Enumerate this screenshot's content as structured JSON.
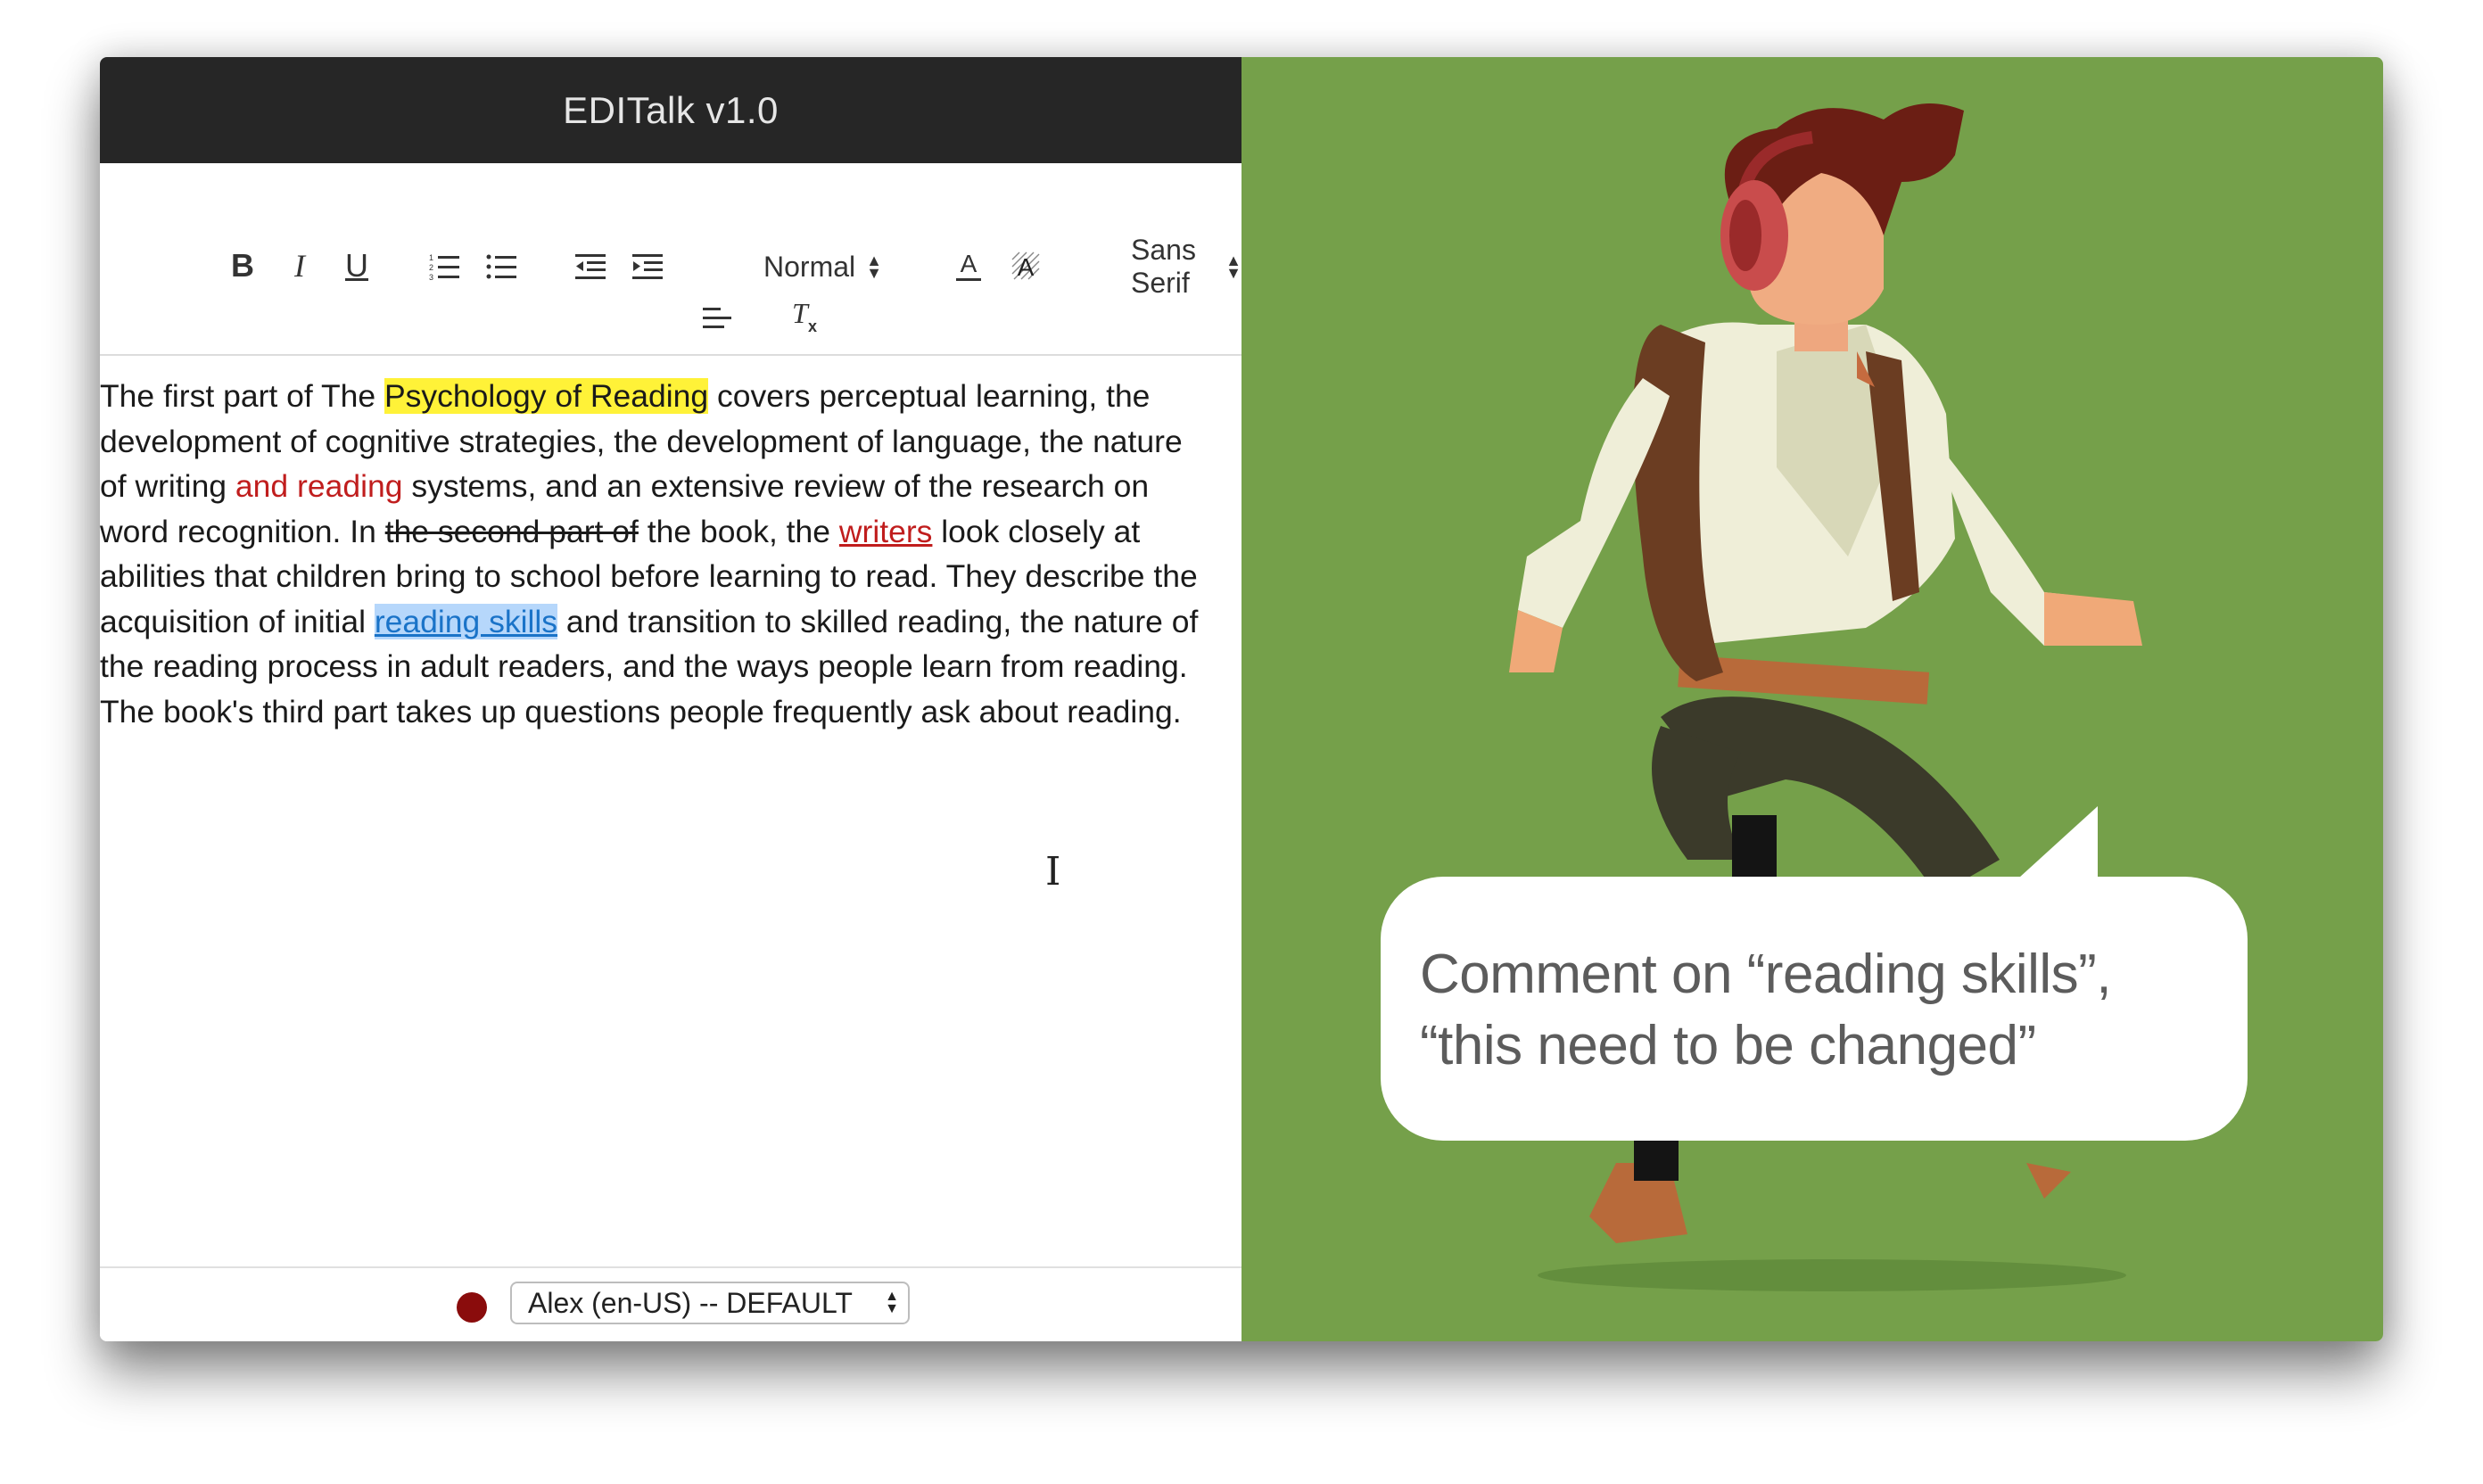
{
  "app": {
    "title": "EDITalk v1.0"
  },
  "toolbar": {
    "bold": "B",
    "italic": "I",
    "underline": "U",
    "header_select": "Normal",
    "font_select": "Sans Serif"
  },
  "document": {
    "lines": [
      [
        {
          "t": "The first part of The "
        },
        {
          "t": "Psychology of Reading",
          "s": "hl"
        },
        {
          "t": " covers perceptual learning, the"
        }
      ],
      [
        {
          "t": "development of cognitive strategies, the development of language, the nature"
        }
      ],
      [
        {
          "t": "of writing "
        },
        {
          "t": "and reading",
          "s": "red"
        },
        {
          "t": " systems, and an extensive review of the research on"
        }
      ],
      [
        {
          "t": "word recognition. In "
        },
        {
          "t": "the second part of",
          "s": "strike"
        },
        {
          "t": " the book, the "
        },
        {
          "t": "writers",
          "s": "redline"
        },
        {
          "t": " look closely at"
        }
      ],
      [
        {
          "t": "abilities that children bring to school before learning to read. They describe the"
        }
      ],
      [
        {
          "t": "acquisition of initial "
        },
        {
          "t": "reading skills",
          "s": "sel"
        },
        {
          "t": " and transition to skilled reading, the nature of"
        }
      ],
      [
        {
          "t": "the reading process in adult readers, and the ways people learn from reading."
        }
      ],
      [
        {
          "t": "The book's third part takes up questions people frequently ask about reading."
        }
      ]
    ]
  },
  "footer": {
    "record_color": "#8a0c0c",
    "voice_select": "Alex (en-US) -- DEFAULT"
  },
  "video": {
    "background": "#75a04a",
    "bubble_text": "Comment on “reading skills”, “this need to be changed”"
  }
}
